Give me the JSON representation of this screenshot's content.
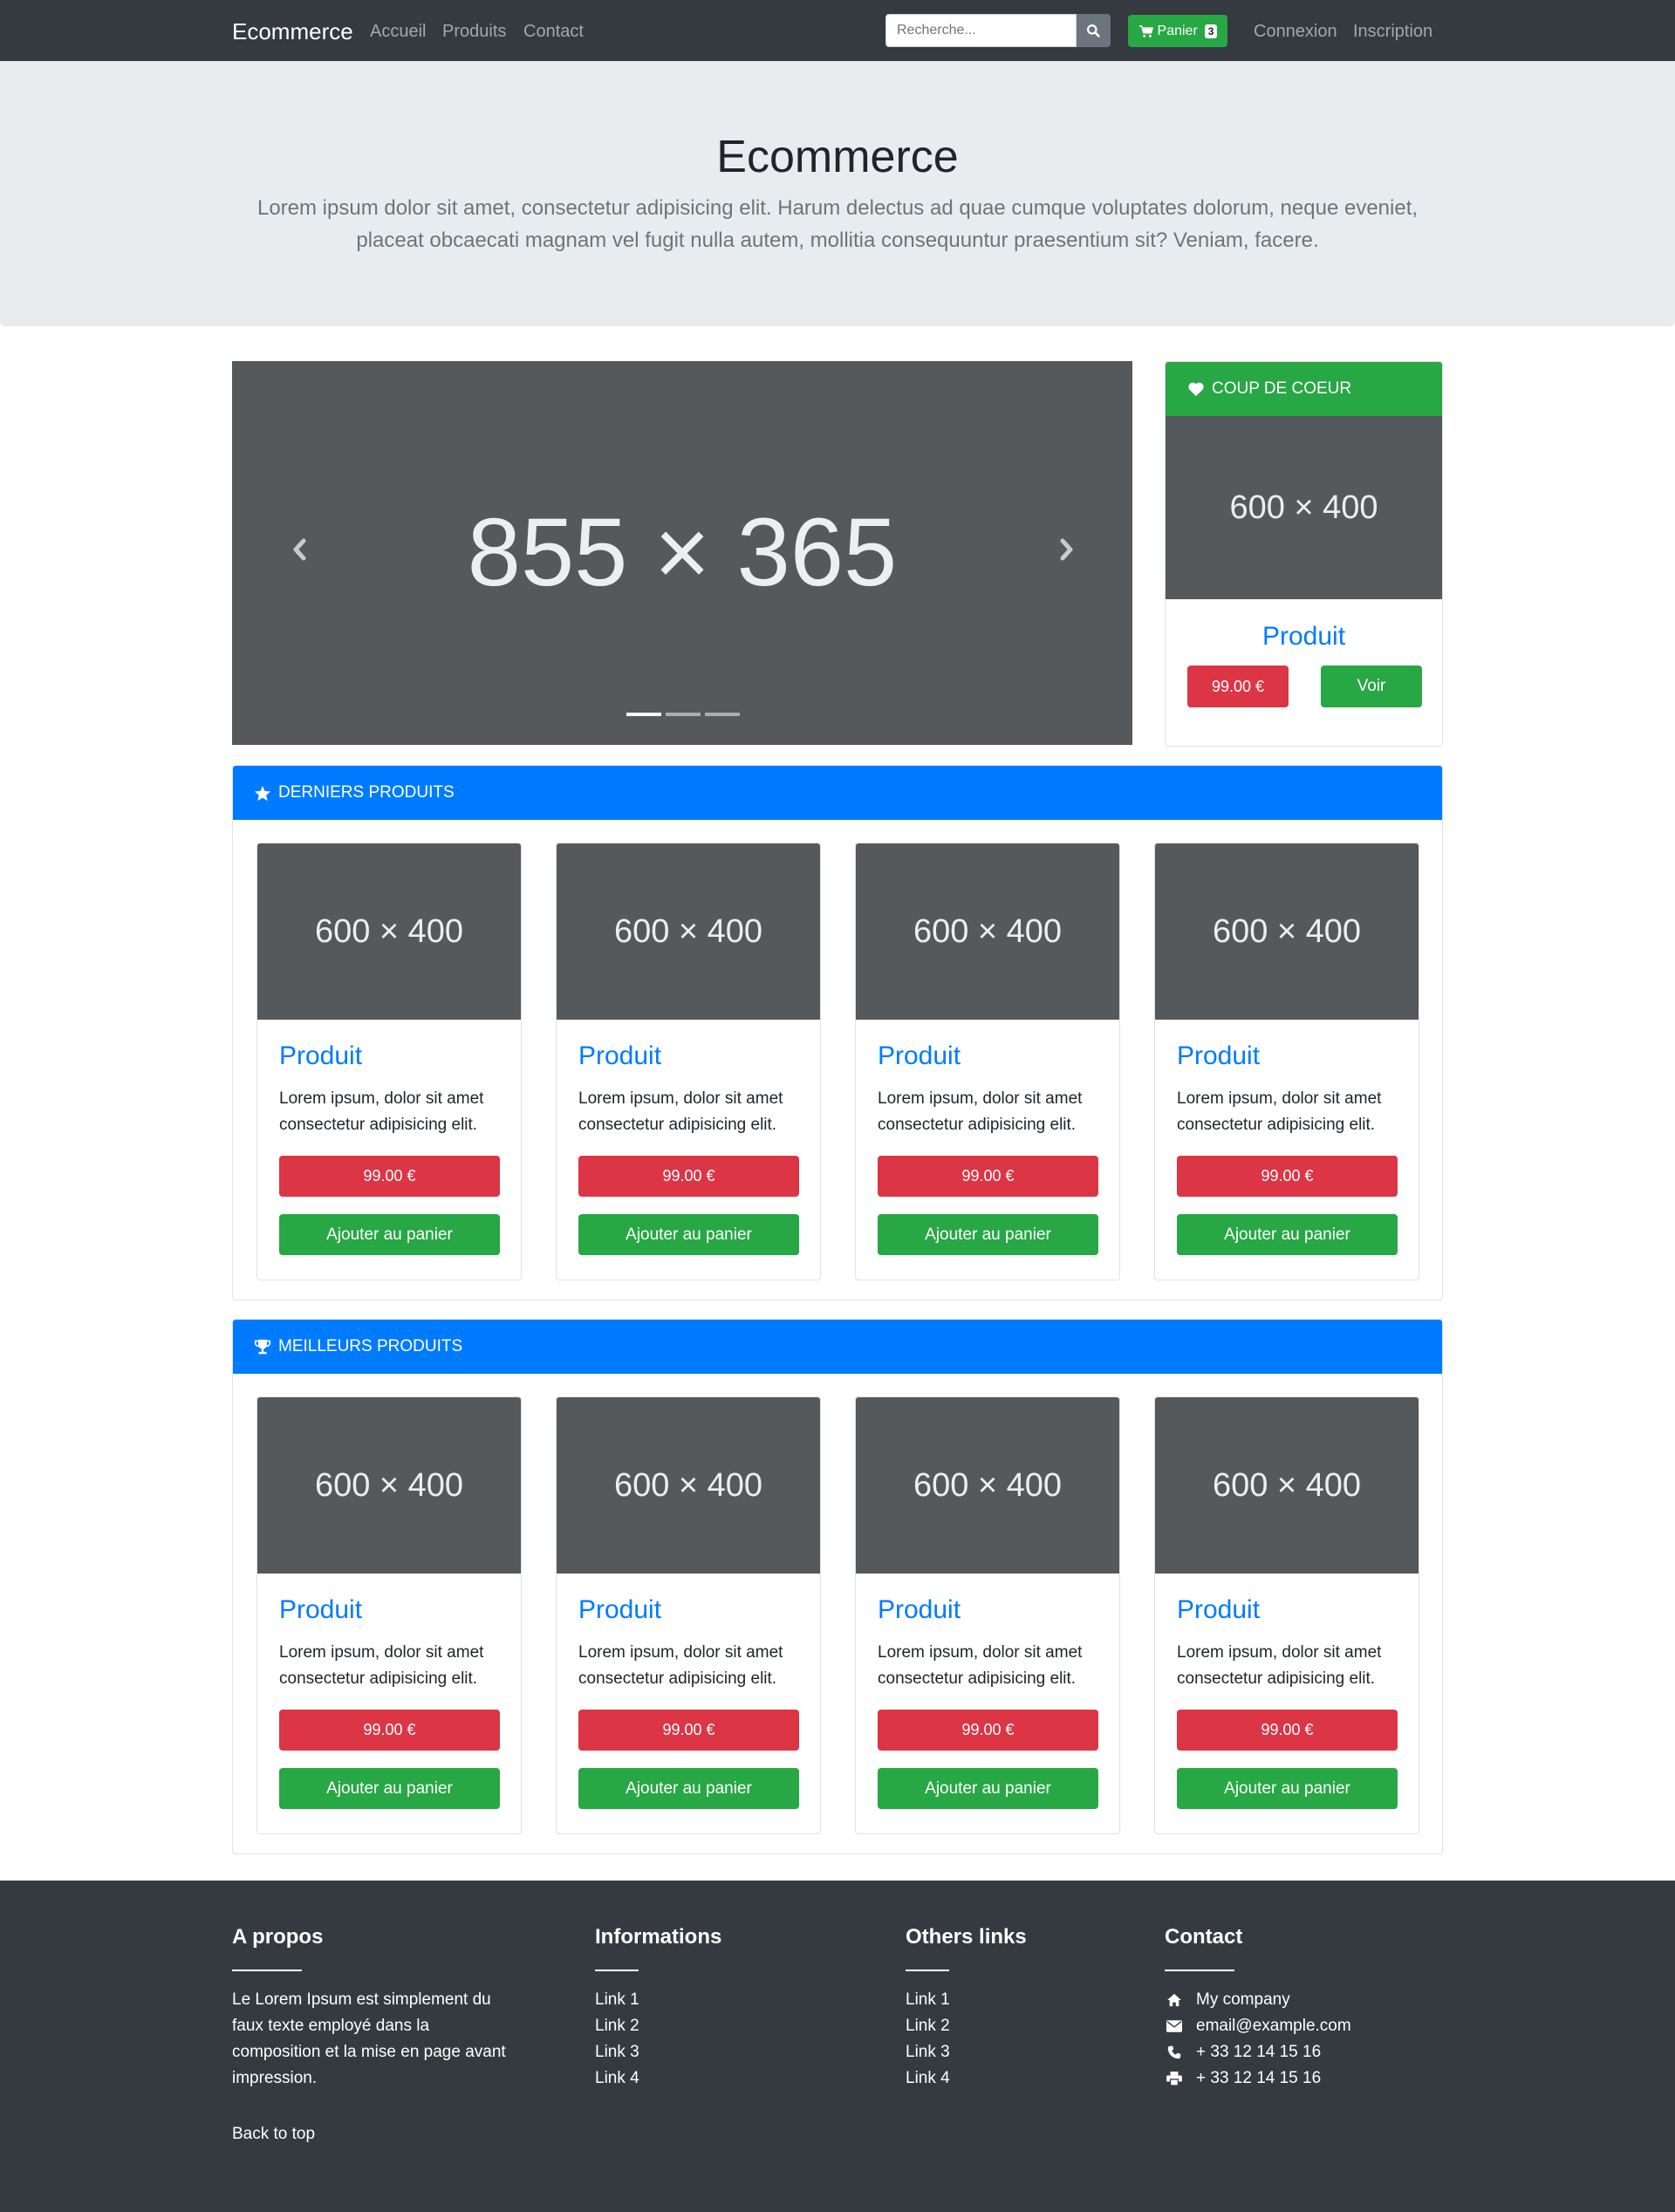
{
  "navbar": {
    "brand": "Ecommerce",
    "links": [
      "Accueil",
      "Produits",
      "Contact"
    ],
    "search_placeholder": "Recherche...",
    "cart_label": "Panier",
    "cart_count": "3",
    "auth": [
      "Connexion",
      "Inscription"
    ]
  },
  "jumbotron": {
    "title": "Ecommerce",
    "lead": "Lorem ipsum dolor sit amet, consectetur adipisicing elit. Harum delectus ad quae cumque voluptates dolorum, neque eveniet, placeat obcaecati magnam vel fugit nulla autem, mollitia consequuntur praesentium sit? Veniam, facere."
  },
  "carousel": {
    "placeholder": "855 × 365",
    "slides": 3,
    "active": 0
  },
  "favorite": {
    "header": "COUP DE COEUR",
    "image": "600 × 400",
    "title": "Produit",
    "price": "99.00 €",
    "view": "Voir"
  },
  "latest": {
    "header": "DERNIERS PRODUITS",
    "products": [
      {
        "image": "600 × 400",
        "title": "Produit",
        "desc": "Lorem ipsum, dolor sit amet consectetur adipisicing elit.",
        "price": "99.00 €",
        "cta": "Ajouter au panier"
      },
      {
        "image": "600 × 400",
        "title": "Produit",
        "desc": "Lorem ipsum, dolor sit amet consectetur adipisicing elit.",
        "price": "99.00 €",
        "cta": "Ajouter au panier"
      },
      {
        "image": "600 × 400",
        "title": "Produit",
        "desc": "Lorem ipsum, dolor sit amet consectetur adipisicing elit.",
        "price": "99.00 €",
        "cta": "Ajouter au panier"
      },
      {
        "image": "600 × 400",
        "title": "Produit",
        "desc": "Lorem ipsum, dolor sit amet consectetur adipisicing elit.",
        "price": "99.00 €",
        "cta": "Ajouter au panier"
      }
    ]
  },
  "best": {
    "header": "MEILLEURS PRODUITS",
    "products": [
      {
        "image": "600 × 400",
        "title": "Produit",
        "desc": "Lorem ipsum, dolor sit amet consectetur adipisicing elit.",
        "price": "99.00 €",
        "cta": "Ajouter au panier"
      },
      {
        "image": "600 × 400",
        "title": "Produit",
        "desc": "Lorem ipsum, dolor sit amet consectetur adipisicing elit.",
        "price": "99.00 €",
        "cta": "Ajouter au panier"
      },
      {
        "image": "600 × 400",
        "title": "Produit",
        "desc": "Lorem ipsum, dolor sit amet consectetur adipisicing elit.",
        "price": "99.00 €",
        "cta": "Ajouter au panier"
      },
      {
        "image": "600 × 400",
        "title": "Produit",
        "desc": "Lorem ipsum, dolor sit amet consectetur adipisicing elit.",
        "price": "99.00 €",
        "cta": "Ajouter au panier"
      }
    ]
  },
  "footer": {
    "about": {
      "title": "A propos",
      "text": "Le Lorem Ipsum est simplement du faux texte employé dans la composition et la mise en page avant impression."
    },
    "informations": {
      "title": "Informations",
      "links": [
        "Link 1",
        "Link 2",
        "Link 3",
        "Link 4"
      ]
    },
    "others": {
      "title": "Others links",
      "links": [
        "Link 1",
        "Link 2",
        "Link 3",
        "Link 4"
      ]
    },
    "contact": {
      "title": "Contact",
      "company": "My company",
      "email": "email@example.com",
      "phone": "+ 33 12 14 15 16",
      "fax": "+ 33 12 14 15 16"
    },
    "back_to_top": "Back to top"
  },
  "colors": {
    "primary": "#007bff",
    "success": "#28a745",
    "danger": "#dc3545",
    "dark": "#343a40",
    "placeholder": "#55595c"
  }
}
